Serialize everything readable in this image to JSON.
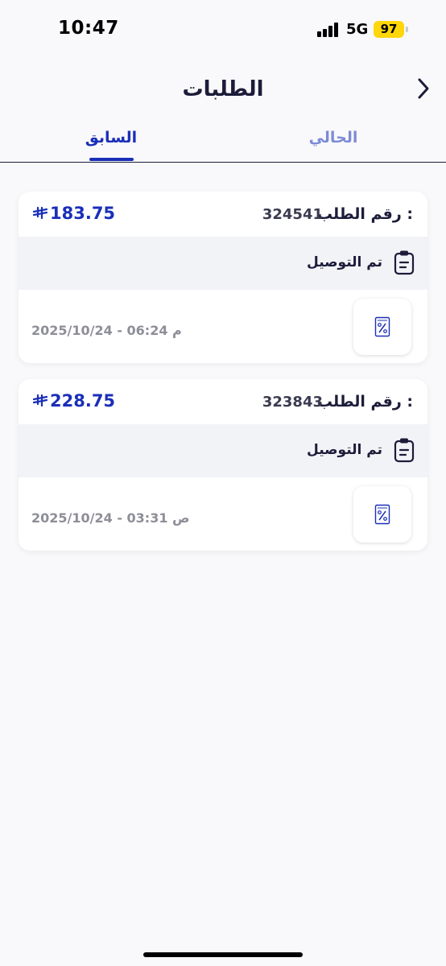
{
  "status_bar": {
    "time": "10:47",
    "network": "5G",
    "battery": "97",
    "battery_color": "#ffd60a"
  },
  "header": {
    "title": "الطلبات",
    "back_icon": "chevron-right-icon"
  },
  "tabs": {
    "previous": "السابق",
    "current": "الحالي",
    "active": "previous"
  },
  "colors": {
    "accent": "#1a2fb8",
    "inactive_tab": "#7c8bd6",
    "status_band": "#f2f3f7"
  },
  "orders": [
    {
      "label": "رقم الطلب :",
      "number": "324541",
      "price": "183.75",
      "status_icon": "clipboard-icon",
      "status": "تم التوصيل",
      "invoice_icon": "invoice-percent-icon",
      "datetime": "2025/10/24 - 06:24 م"
    },
    {
      "label": "رقم الطلب :",
      "number": "323843",
      "price": "228.75",
      "status_icon": "clipboard-icon",
      "status": "تم التوصيل",
      "invoice_icon": "invoice-percent-icon",
      "datetime": "2025/10/24 - 03:31 ص"
    }
  ]
}
